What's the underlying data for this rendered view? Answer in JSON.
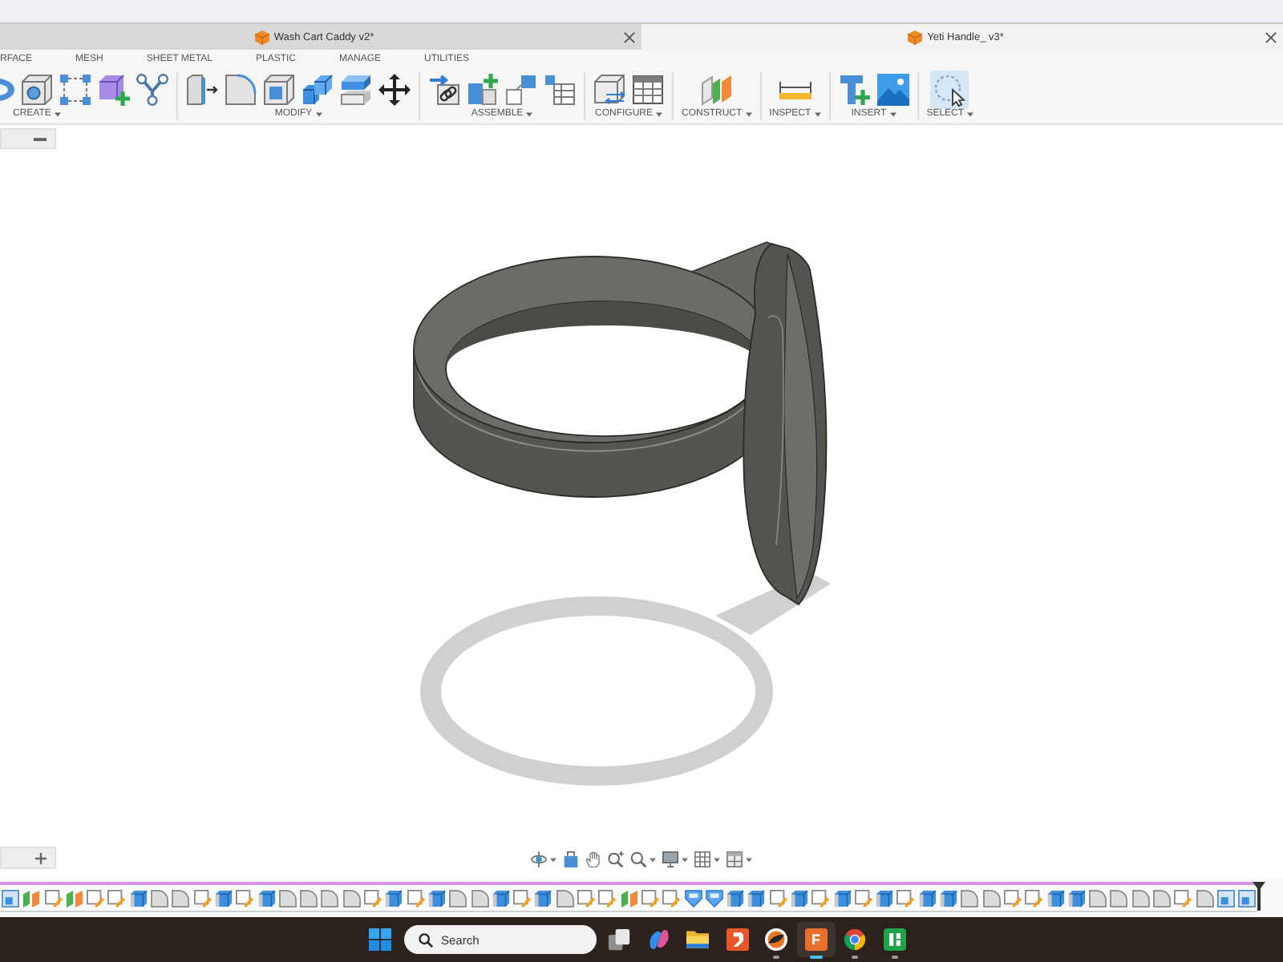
{
  "document_tabs": [
    {
      "title": "Wash Cart Caddy v2*",
      "selected": false
    },
    {
      "title": "Yeti Handle_ v3*",
      "selected": true
    }
  ],
  "toolbar_tabs": [
    "RFACE",
    "MESH",
    "SHEET METAL",
    "PLASTIC",
    "MANAGE",
    "UTILITIES"
  ],
  "toolbar_groups": [
    {
      "label": "CREATE",
      "tools": [
        {
          "kind": "arc",
          "selected": false
        },
        {
          "kind": "cube-hole",
          "selected": false
        },
        {
          "kind": "rect-pattern",
          "selected": false
        },
        {
          "kind": "cube-plus",
          "selected": false
        },
        {
          "kind": "branch",
          "selected": false
        }
      ]
    },
    {
      "label": "MODIFY",
      "tools": [
        {
          "kind": "press-pull",
          "selected": false
        },
        {
          "kind": "fillet",
          "selected": false
        },
        {
          "kind": "shell",
          "selected": false
        },
        {
          "kind": "cube-pair",
          "selected": false
        },
        {
          "kind": "slab-stack",
          "selected": false
        },
        {
          "kind": "move",
          "selected": false
        }
      ]
    },
    {
      "label": "ASSEMBLE",
      "tools": [
        {
          "kind": "joint",
          "selected": false
        },
        {
          "kind": "component-plus",
          "selected": false
        },
        {
          "kind": "offset-squares",
          "selected": false
        },
        {
          "kind": "table",
          "selected": false
        }
      ]
    },
    {
      "label": "CONFIGURE",
      "tools": [
        {
          "kind": "configure",
          "selected": false
        },
        {
          "kind": "table-grid",
          "selected": false
        }
      ]
    },
    {
      "label": "CONSTRUCT",
      "tools": [
        {
          "kind": "planes",
          "selected": false
        }
      ]
    },
    {
      "label": "INSPECT",
      "tools": [
        {
          "kind": "measure",
          "selected": false
        }
      ]
    },
    {
      "label": "INSERT",
      "tools": [
        {
          "kind": "insert-plus",
          "selected": false
        },
        {
          "kind": "image",
          "selected": false
        }
      ]
    },
    {
      "label": "SELECT",
      "tools": [
        {
          "kind": "select",
          "selected": true
        }
      ]
    }
  ],
  "timeline": {
    "features": [
      {
        "kind": "frame"
      },
      {
        "kind": "plane"
      },
      {
        "kind": "sketch"
      },
      {
        "kind": "plane"
      },
      {
        "kind": "sketch"
      },
      {
        "kind": "sketch"
      },
      {
        "kind": "extrude"
      },
      {
        "kind": "fillet"
      },
      {
        "kind": "fillet"
      },
      {
        "kind": "sketch"
      },
      {
        "kind": "extrude"
      },
      {
        "kind": "sketch"
      },
      {
        "kind": "extrude"
      },
      {
        "kind": "fillet"
      },
      {
        "kind": "fillet"
      },
      {
        "kind": "fillet"
      },
      {
        "kind": "fillet"
      },
      {
        "kind": "sketch"
      },
      {
        "kind": "extrude"
      },
      {
        "kind": "sketch"
      },
      {
        "kind": "extrude"
      },
      {
        "kind": "fillet"
      },
      {
        "kind": "fillet"
      },
      {
        "kind": "extrude"
      },
      {
        "kind": "sketch"
      },
      {
        "kind": "extrude"
      },
      {
        "kind": "fillet"
      },
      {
        "kind": "sketch"
      },
      {
        "kind": "sketch"
      },
      {
        "kind": "plane"
      },
      {
        "kind": "sketch"
      },
      {
        "kind": "sketch"
      },
      {
        "kind": "shell"
      },
      {
        "kind": "shell"
      },
      {
        "kind": "extrude"
      },
      {
        "kind": "extrude"
      },
      {
        "kind": "sketch"
      },
      {
        "kind": "extrude"
      },
      {
        "kind": "sketch"
      },
      {
        "kind": "extrude"
      },
      {
        "kind": "sketch"
      },
      {
        "kind": "extrude"
      },
      {
        "kind": "sketch"
      },
      {
        "kind": "extrude"
      },
      {
        "kind": "extrude"
      },
      {
        "kind": "fillet"
      },
      {
        "kind": "fillet"
      },
      {
        "kind": "sketch"
      },
      {
        "kind": "sketch"
      },
      {
        "kind": "extrude"
      },
      {
        "kind": "extrude"
      },
      {
        "kind": "fillet"
      },
      {
        "kind": "fillet"
      },
      {
        "kind": "fillet"
      },
      {
        "kind": "fillet"
      },
      {
        "kind": "sketch"
      },
      {
        "kind": "fillet"
      },
      {
        "kind": "frame"
      },
      {
        "kind": "frame"
      }
    ]
  },
  "taskbar": {
    "search": {
      "placeholder": "Search"
    },
    "apps": [
      {
        "kind": "task-view",
        "running": false,
        "selected": false
      },
      {
        "kind": "swirl",
        "running": false,
        "selected": false
      },
      {
        "kind": "folder",
        "running": false,
        "selected": false
      },
      {
        "kind": "arrow-tile",
        "running": false,
        "selected": false
      },
      {
        "kind": "round-logo",
        "running": true,
        "selected": false
      },
      {
        "kind": "letter-tile",
        "label": "F",
        "running": true,
        "selected": true
      },
      {
        "kind": "browser",
        "running": true,
        "selected": false
      },
      {
        "kind": "grid-tile",
        "running": true,
        "selected": false
      }
    ]
  }
}
